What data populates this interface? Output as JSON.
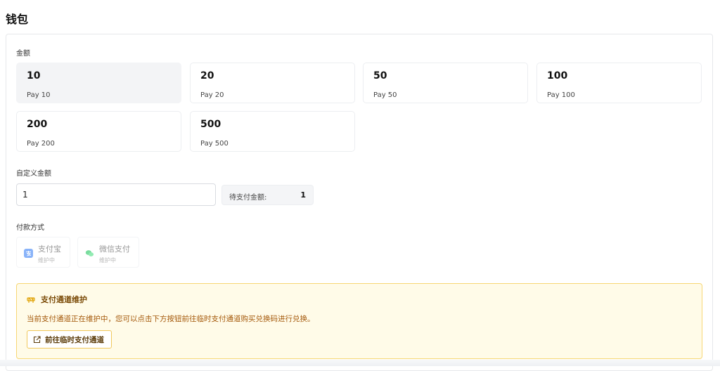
{
  "page": {
    "title": "钱包"
  },
  "amount_section": {
    "label": "金额",
    "options": [
      {
        "value": "10",
        "desc": "Pay 10",
        "selected": true
      },
      {
        "value": "20",
        "desc": "Pay 20",
        "selected": false
      },
      {
        "value": "50",
        "desc": "Pay 50",
        "selected": false
      },
      {
        "value": "100",
        "desc": "Pay 100",
        "selected": false
      },
      {
        "value": "200",
        "desc": "Pay 200",
        "selected": false
      },
      {
        "value": "500",
        "desc": "Pay 500",
        "selected": false
      }
    ]
  },
  "custom_amount": {
    "label": "自定义金额",
    "value": "1",
    "pending_label": "待支付金额:",
    "pending_value": "1"
  },
  "payment": {
    "label": "付款方式",
    "methods": [
      {
        "name": "支付宝",
        "status": "维护中",
        "icon": "alipay-icon",
        "color": "#3b82f6"
      },
      {
        "name": "微信支付",
        "status": "维护中",
        "icon": "wechat-icon",
        "color": "#22c55e"
      }
    ]
  },
  "notice": {
    "icon": "maintenance-icon",
    "title": "支付通道维护",
    "text": "当前支付通道正在维护中，您可以点击下方按钮前往临时支付通道购买兑换码进行兑换。",
    "button_label": "前往临时支付通道",
    "button_icon": "external-link-icon",
    "accent": "#f0b400"
  }
}
